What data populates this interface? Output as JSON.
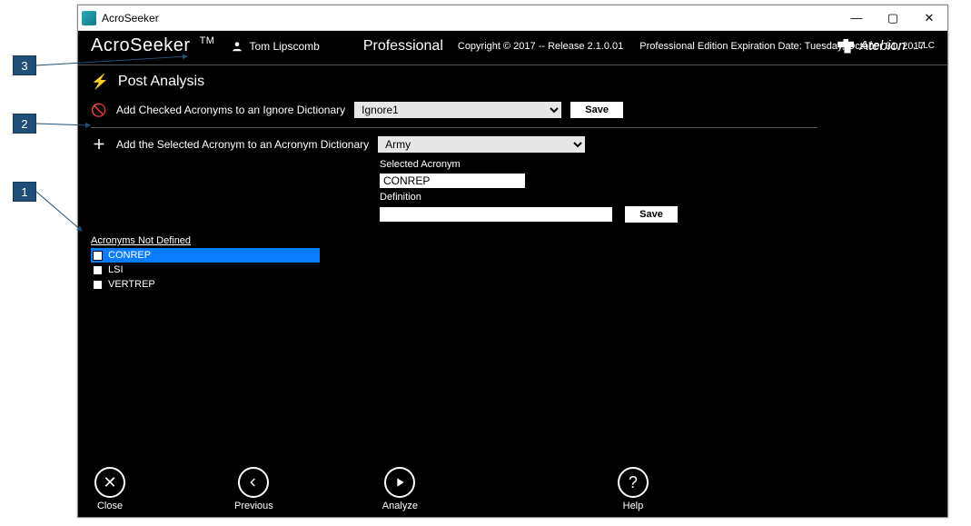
{
  "callouts": {
    "one": "1",
    "two": "2",
    "three": "3"
  },
  "window": {
    "title": "AcroSeeker"
  },
  "header": {
    "app_name": "AcroSeeker",
    "tm": "TM",
    "user_name": "Tom Lipscomb",
    "edition": "Professional",
    "copyright": "Copyright © 2017 -- Release 2.1.0.01",
    "expiry": "Professional Edition Expiration Date: Tuesday, October 31, 2017",
    "brand": "Atebion",
    "brand_suffix": "LLC"
  },
  "post_analysis": {
    "title": "Post Analysis",
    "ignore": {
      "label": "Add Checked Acronyms to an Ignore Dictionary",
      "selected": "Ignore1",
      "save": "Save"
    },
    "acronym_dict": {
      "label": "Add the Selected Acronym to an Acronym Dictionary",
      "selected": "Army",
      "selected_acr_label": "Selected Acronym",
      "selected_acr_value": "CONREP",
      "definition_label": "Definition",
      "definition_value": "",
      "save": "Save"
    },
    "list": {
      "header": "Acronyms Not Defined",
      "items": [
        {
          "text": "CONREP",
          "checked": false,
          "selected": true
        },
        {
          "text": "LSI",
          "checked": false,
          "selected": false
        },
        {
          "text": "VERTREP",
          "checked": false,
          "selected": false
        }
      ]
    }
  },
  "nav": {
    "close": "Close",
    "previous": "Previous",
    "analyze": "Analyze",
    "help": "Help"
  }
}
